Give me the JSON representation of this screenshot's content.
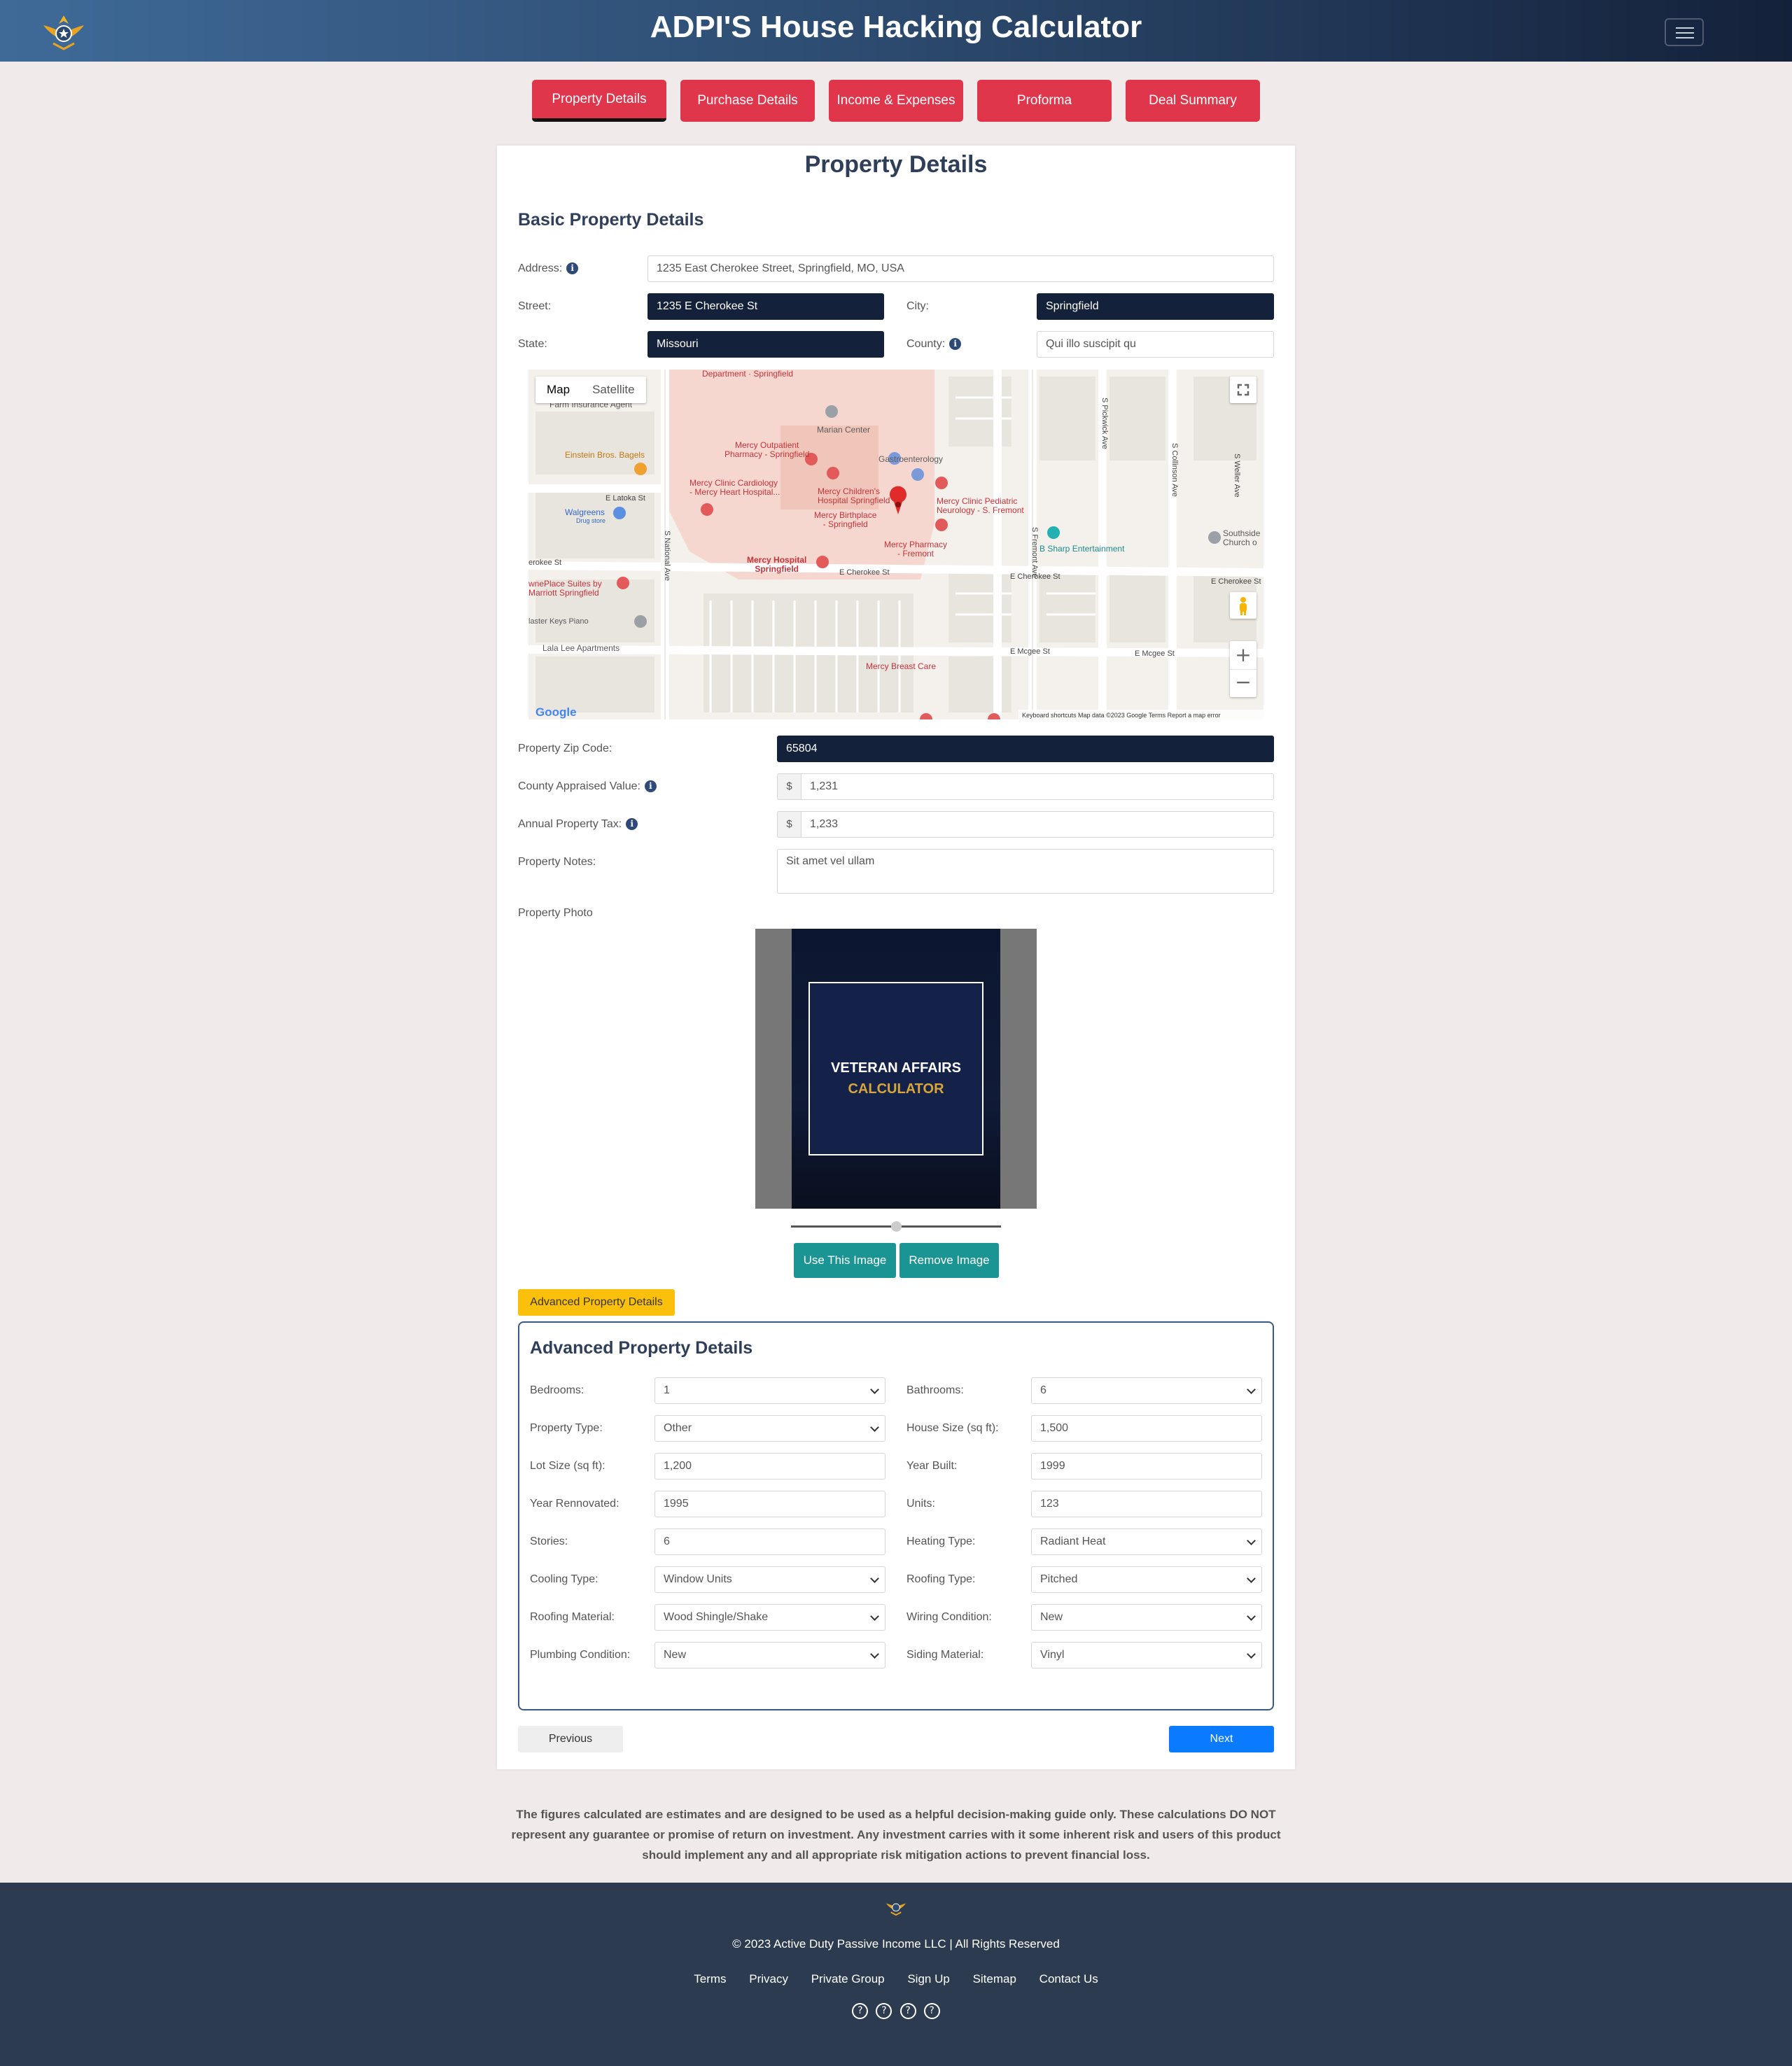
{
  "header": {
    "title": "ADPI'S House Hacking Calculator",
    "logo_icon": "eagle-emblem-logo",
    "menu_icon": "hamburger-menu-icon"
  },
  "tabs": [
    {
      "label": "Property Details",
      "active": true
    },
    {
      "label": "Purchase Details",
      "active": false
    },
    {
      "label": "Income & Expenses",
      "active": false
    },
    {
      "label": "Proforma",
      "active": false
    },
    {
      "label": "Deal Summary",
      "active": false
    }
  ],
  "page_title": "Property Details",
  "basic": {
    "section_title": "Basic Property Details",
    "address_label": "Address:",
    "address_value": "1235 East Cherokee Street, Springfield, MO, USA",
    "street_label": "Street:",
    "street_value": "1235 E Cherokee St",
    "city_label": "City:",
    "city_value": "Springfield",
    "state_label": "State:",
    "state_value": "Missouri",
    "county_label": "County:",
    "county_value": "Qui illo suscipit qu",
    "zip_label": "Property Zip Code:",
    "zip_value": "65804",
    "appraised_label": "County Appraised Value:",
    "appraised_value": "1,231",
    "tax_label": "Annual Property Tax:",
    "tax_value": "1,233",
    "currency_symbol": "$",
    "notes_label": "Property Notes:",
    "notes_value": "Sit amet vel ullam",
    "photo_label": "Property Photo",
    "info_icon": "i"
  },
  "map": {
    "tab_map": "Map",
    "tab_satellite": "Satellite",
    "zoom_in": "+",
    "zoom_out": "−",
    "google": "Google",
    "attribution": "Keyboard shortcuts   Map data ©2023 Google   Terms   Report a map error",
    "places": {
      "department": "Department · Springfield",
      "farm": "Farm Insurance Agent",
      "marian": "Marian Center",
      "einstein": "Einstein Bros. Bagels",
      "outpatient": "Mercy Outpatient\nPharmacy - Springfield",
      "gastro": "Gastroenterology",
      "cardiology": "Mercy Clinic Cardiology\n- Mercy Heart Hospital...",
      "childrens": "Mercy Children's\nHospital Springfield",
      "birthplace": "Mercy Birthplace\n- Springfield",
      "pediatric": "Mercy Clinic Pediatric\nNeurology - S. Fremont",
      "latoka": "E Latoka St",
      "walgreens": "Walgreens",
      "drugstore": "Drug store",
      "fremont_pharmacy": "Mercy Pharmacy\n- Fremont",
      "bsharp": "B Sharp Entertainment",
      "southside": "Southside\nChurch o",
      "hospital": "Mercy Hospital\nSpringfield",
      "cherokee_w": "erokee St",
      "cherokee_1": "E Cherokee St",
      "cherokee_2": "E Cherokee St",
      "cherokee_3": "E Cherokee St",
      "towneplace": "wnePlace Suites by\nMarriott Springfield",
      "piano": "laster Keys Piano",
      "lalalee": "Lala Lee Apartments",
      "mcgee_1": "E Mcgee St",
      "mcgee_2": "E Mcgee St",
      "breast": "Mercy Breast Care",
      "national": "S National Ave",
      "fremont": "S Fremont Ave",
      "pickwick": "S Pickwick Ave",
      "collinson": "S Collinson Ave",
      "weller": "S Weller Ave"
    }
  },
  "photo": {
    "line1": "VETERAN AFFAIRS",
    "line2": "CALCULATOR",
    "use_button": "Use This Image",
    "remove_button": "Remove Image",
    "zoom_slider": 0.5
  },
  "advanced": {
    "toggle_label": "Advanced Property Details",
    "section_title": "Advanced Property Details",
    "fields": [
      {
        "label": "Bedrooms:",
        "value": "1",
        "type": "select"
      },
      {
        "label": "Bathrooms:",
        "value": "6",
        "type": "select"
      },
      {
        "label": "Property Type:",
        "value": "Other",
        "type": "select"
      },
      {
        "label": "House Size (sq ft):",
        "value": "1,500",
        "type": "input"
      },
      {
        "label": "Lot Size (sq ft):",
        "value": "1,200",
        "type": "input"
      },
      {
        "label": "Year Built:",
        "value": "1999",
        "type": "input"
      },
      {
        "label": "Year Rennovated:",
        "value": "1995",
        "type": "input"
      },
      {
        "label": "Units:",
        "value": "123",
        "type": "input"
      },
      {
        "label": "Stories:",
        "value": "6",
        "type": "input"
      },
      {
        "label": "Heating Type:",
        "value": "Radiant Heat",
        "type": "select"
      },
      {
        "label": "Cooling Type:",
        "value": "Window Units",
        "type": "select"
      },
      {
        "label": "Roofing Type:",
        "value": "Pitched",
        "type": "select"
      },
      {
        "label": "Roofing Material:",
        "value": "Wood Shingle/Shake",
        "type": "select"
      },
      {
        "label": "Wiring Condition:",
        "value": "New",
        "type": "select"
      },
      {
        "label": "Plumbing Condition:",
        "value": "New",
        "type": "select"
      },
      {
        "label": "Siding Material:",
        "value": "Vinyl",
        "type": "select"
      }
    ]
  },
  "nav": {
    "previous": "Previous",
    "next": "Next"
  },
  "disclaimer": "The figures calculated are estimates and are designed to be used as a helpful decision-making guide only. These calculations DO NOT represent any guarantee or promise of return on investment. Any investment carries with it some inherent risk and users of this product should implement any and all appropriate risk mitigation actions to prevent financial loss.",
  "footer": {
    "copyright": "© 2023 Active Duty Passive Income LLC | All Rights Reserved",
    "links": [
      "Terms",
      "Privacy",
      "Private Group",
      "Sign Up",
      "Sitemap",
      "Contact Us"
    ],
    "social_icons": [
      "?",
      "?",
      "?",
      "?"
    ]
  },
  "colors": {
    "accent_red": "#e0364c",
    "navy": "#14213a",
    "teal": "#1a9593",
    "yellow": "#fbc00c",
    "blue": "#0a7bff",
    "footer": "#2c3b50"
  }
}
